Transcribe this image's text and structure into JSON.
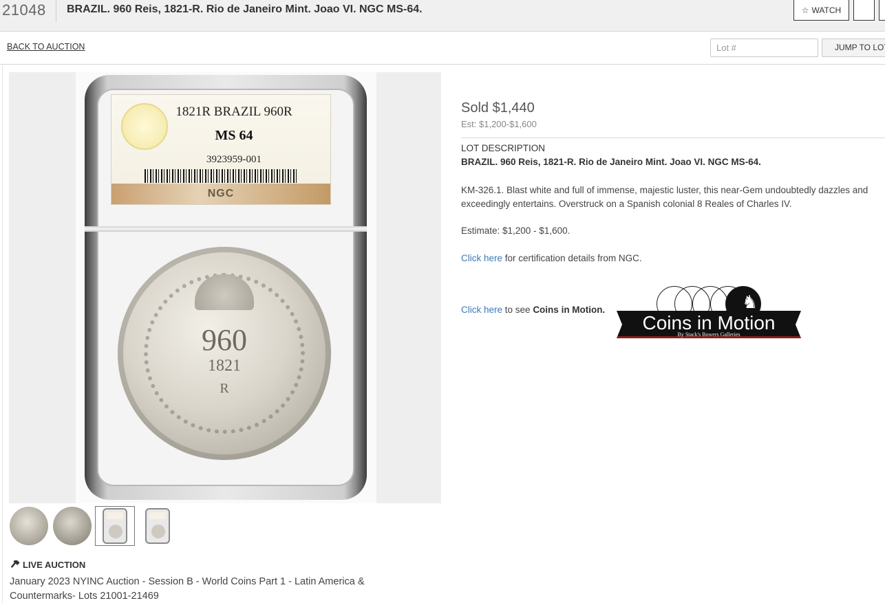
{
  "header": {
    "lot_number": "21048",
    "title": "BRAZIL. 960 Reis, 1821-R. Rio de Janeiro Mint. Joao VI. NGC MS-64.",
    "watch_label": "WATCH",
    "watch_icon": "star-outline-icon"
  },
  "nav": {
    "back_label": "BACK TO AUCTION",
    "lot_placeholder": "Lot #",
    "jump_label": "JUMP TO LOT"
  },
  "image": {
    "label_line1": "1821R BRAZIL 960R",
    "label_grade": "MS 64",
    "label_cert": "3923959-001",
    "label_band": "NGC",
    "coin_value": "960",
    "coin_year": "1821",
    "coin_mint": "R"
  },
  "thumbnails": [
    {
      "kind": "coin-obverse"
    },
    {
      "kind": "coin-reverse"
    },
    {
      "kind": "slab-front",
      "selected": true
    },
    {
      "kind": "slab-back"
    }
  ],
  "auction": {
    "live_label": "LIVE AUCTION",
    "live_icon": "gavel-icon",
    "name": "January 2023 NYINC Auction - Session B - World Coins Part 1 - Latin America & Countermarks- Lots 21001-21469"
  },
  "lot": {
    "sold": "Sold $1,440",
    "estimate_short": "Est: $1,200-$1,600",
    "description_heading": "LOT DESCRIPTION",
    "description_title": "BRAZIL. 960 Reis, 1821-R. Rio de Janeiro Mint. Joao VI. NGC MS-64.",
    "description_body": "KM-326.1. Blast white and full of immense, majestic luster, this near-Gem undoubtedly dazzles and exceedingly entertains. Overstruck on a Spanish colonial 8 Reales of Charles IV.",
    "estimate_line": "Estimate: $1,200 - $1,600.",
    "cert_link": "Click here",
    "cert_text": " for certification details from NGC.",
    "motion_link": "Click here",
    "motion_text": " to see ",
    "motion_bold": "Coins in Motion."
  },
  "logo": {
    "title": "Coins in Motion",
    "subtitle": "By Stack's Bowers Galleries"
  },
  "colors": {
    "link": "#3d7ab8",
    "header_bg": "#f0f0f0",
    "logo_accent": "#8b1c1c"
  }
}
